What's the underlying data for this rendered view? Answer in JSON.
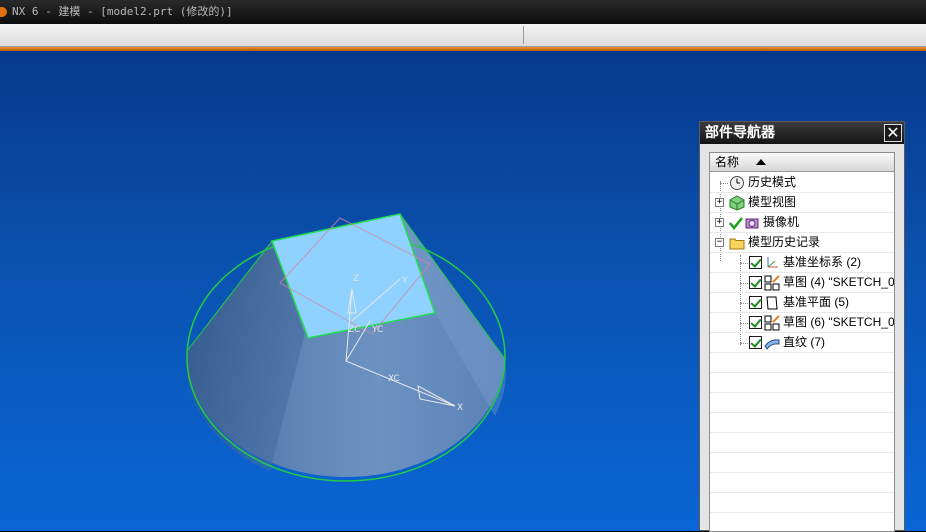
{
  "window": {
    "title": "NX 6 - 建模 - [model2.prt (修改的)]"
  },
  "viewport": {
    "axis_labels": {
      "zc": "ZC",
      "yc": "YC",
      "xc": "XC",
      "x": "X",
      "y": "Y",
      "z": "Z"
    },
    "colors": {
      "background_top": "#07398b",
      "background_bottom": "#0a66d6",
      "cone_edge": "#22cc44",
      "plane_fill": "#8fd2ff"
    }
  },
  "part_navigator": {
    "title": "部件导航器",
    "column_header": "名称",
    "items": [
      {
        "label": "历史模式",
        "icon": "clock-icon"
      },
      {
        "label": "模型视图",
        "icon": "model-view-icon",
        "expander": "+"
      },
      {
        "label": "摄像机",
        "icon": "camera-icon",
        "expander": "+"
      },
      {
        "label": "模型历史记录",
        "icon": "folder-icon",
        "expander": "−"
      },
      {
        "label": "基准坐标系 (2)",
        "icon": "datum-csys-icon",
        "checked": true
      },
      {
        "label": "草图 (4) \"SKETCH_0",
        "icon": "sketch-icon",
        "checked": true
      },
      {
        "label": "基准平面 (5)",
        "icon": "datum-plane-icon",
        "checked": true
      },
      {
        "label": "草图 (6) \"SKETCH_0",
        "icon": "sketch-icon",
        "checked": true
      },
      {
        "label": "直纹 (7)",
        "icon": "ruled-surface-icon",
        "checked": true
      }
    ]
  }
}
